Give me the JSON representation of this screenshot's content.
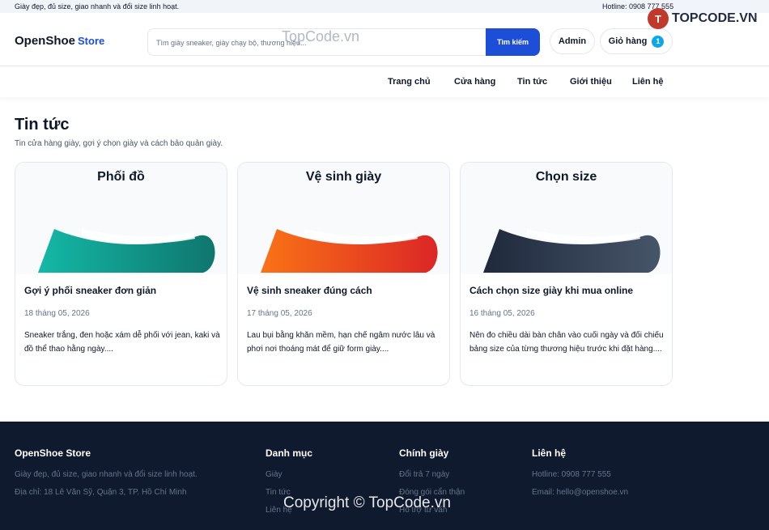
{
  "topbar": {
    "tagline": "Giày đẹp, đủ size, giao nhanh và đổi size linh hoạt.",
    "hotline": "Hotline: 0908 777 555"
  },
  "watermark": {
    "logo_text": "TOPCODE.VN",
    "text": "TopCode.vn",
    "copyright": "Copyright © TopCode.vn"
  },
  "header": {
    "brand": "OpenShoe",
    "brand_suffix": "Store",
    "search_placeholder": "Tìm giày sneaker, giày chạy bộ, thương hiệu...",
    "search_button": "Tìm kiếm",
    "admin": "Admin",
    "cart_label": "Giỏ hàng",
    "cart_count": "1"
  },
  "nav": [
    "Trang chủ",
    "Cửa hàng",
    "Tin tức",
    "Giới thiệu",
    "Liên hệ"
  ],
  "page": {
    "title": "Tin tức",
    "subtitle": "Tin cửa hàng giày, gợi ý chọn giày và cách bảo quản giày."
  },
  "cards": [
    {
      "hero_title": "Phối đồ",
      "title": "Gợi ý phối sneaker đơn giản",
      "date": "18 tháng 05, 2026",
      "desc": "Sneaker trắng, đen hoặc xám dễ phối với jean, kaki và đồ thể thao hằng ngày....",
      "color_a": "#14b8a6",
      "color_b": "#0f766e"
    },
    {
      "hero_title": "Vệ sinh giày",
      "title": "Vệ sinh sneaker đúng cách",
      "date": "17 tháng 05, 2026",
      "desc": "Lau bụi bằng khăn mềm, hạn chế ngâm nước lâu và phơi nơi thoáng mát để giữ form giày....",
      "color_a": "#f97316",
      "color_b": "#dc2626"
    },
    {
      "hero_title": "Chọn size",
      "title": "Cách chọn size giày khi mua online",
      "date": "16 tháng 05, 2026",
      "desc": "Nên đo chiều dài bàn chân vào cuối ngày và đối chiếu bảng size của từng thương hiệu trước khi đặt hàng....",
      "color_a": "#1e293b",
      "color_b": "#475569"
    }
  ],
  "footer": {
    "brand": "OpenShoe Store",
    "tagline": "Giày đẹp, đủ size, giao nhanh và đổi size linh hoạt.",
    "address": "Địa chỉ: 18 Lê Văn Sỹ, Quận 3, TP. Hồ Chí Minh",
    "categories_title": "Danh mục",
    "categories": [
      "Giày",
      "Tin tức",
      "Liên hệ"
    ],
    "policy_title": "Chính giày",
    "policies": [
      "Đổi trả 7 ngày",
      "Đóng gói cẩn thận",
      "Hỗ trợ tư vấn"
    ],
    "contact_title": "Liên hệ",
    "hotline": "Hotline: 0908 777 555",
    "email": "Email: hello@openshoe.vn"
  }
}
